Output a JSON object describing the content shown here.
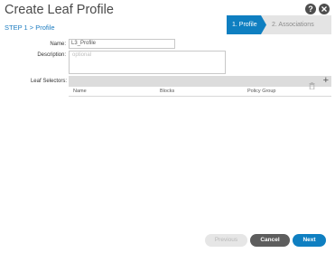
{
  "dialog": {
    "title": "Create Leaf Profile",
    "step_label": "STEP 1 > Profile"
  },
  "header_icons": {
    "help": {
      "icon": "help-icon",
      "glyph": "?"
    },
    "close": {
      "icon": "close-icon"
    }
  },
  "wizard": {
    "steps": [
      {
        "label": "1. Profile",
        "active": true
      },
      {
        "label": "2. Associations",
        "active": false
      }
    ]
  },
  "form": {
    "name_label": "Name:",
    "name_value": "L3_Profile",
    "description_label": "Description:",
    "description_placeholder": "optional",
    "leaf_selectors_label": "Leaf Selectors:"
  },
  "table": {
    "columns": [
      "Name",
      "Blocks",
      "Policy Group"
    ],
    "toolbar": {
      "delete_icon": "trash-icon",
      "add_icon": "plus-icon",
      "add_glyph": "+"
    }
  },
  "footer": {
    "previous_label": "Previous",
    "cancel_label": "Cancel",
    "next_label": "Next"
  },
  "colors": {
    "accent": "#0f7fc1",
    "header_circle": "#4e4e4e",
    "toolbar_bg": "#dcdcdc",
    "cancel_bg": "#5d5d5d"
  }
}
